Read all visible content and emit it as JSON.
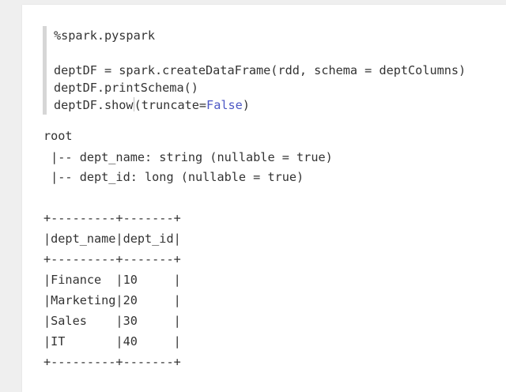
{
  "code": {
    "directive": "%spark.pyspark",
    "line1": "deptDF = spark.createDataFrame(rdd, schema = deptColumns)",
    "line2": "deptDF.printSchema()",
    "line3_prefix": "deptDF.show",
    "line3_open": "(",
    "line3_arg": "truncate=",
    "line3_keyword": "False",
    "line3_close": ")",
    "keyword_color": "#4c57c4"
  },
  "output": {
    "schema_root": "root",
    "schema_fields": [
      " |-- dept_name: string (nullable = true)",
      " |-- dept_id: long (nullable = true)"
    ],
    "table_border": "+---------+-------+",
    "table_header": "|dept_name|dept_id|",
    "table_rows": [
      "|Finance  |10     |",
      "|Marketing|20     |",
      "|Sales    |30     |",
      "|IT       |40     |"
    ]
  }
}
